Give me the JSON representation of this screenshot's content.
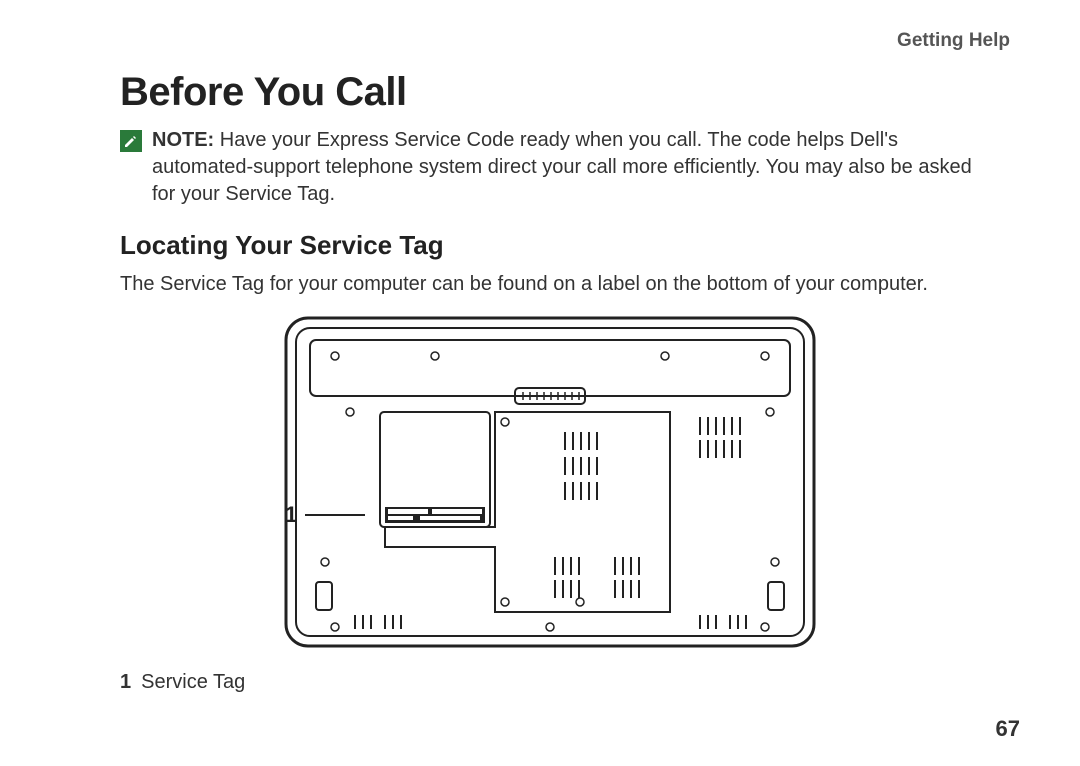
{
  "header": {
    "section": "Getting Help"
  },
  "title": "Before You Call",
  "note": {
    "label": "NOTE:",
    "text": " Have your Express Service Code ready when you call. The code helps Dell's automated-support telephone system direct your call more efficiently. You may also be asked for your Service Tag."
  },
  "subheading": "Locating Your Service Tag",
  "body": "The Service Tag for your computer can be found on a label on the bottom of your computer.",
  "callout": {
    "number": "1"
  },
  "legend": {
    "number": "1",
    "label": "Service Tag"
  },
  "page_number": "67"
}
